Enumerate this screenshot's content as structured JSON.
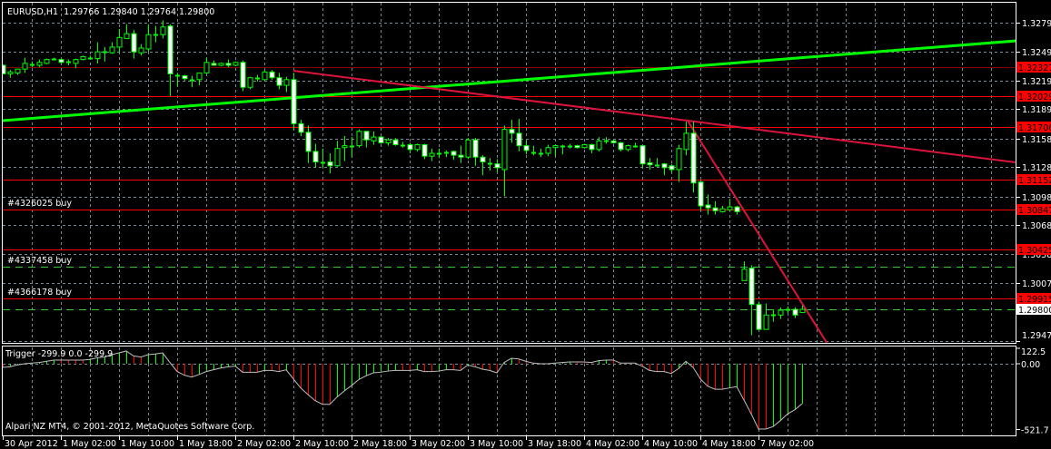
{
  "header": {
    "symbol_info": "EURUSD,H1  1.29766 1.29840 1.29764 1.29800"
  },
  "footer": {
    "copyright": "Alpari NZ MT4, © 2001-2012, MetaQuotes Software Corp."
  },
  "colors": {
    "background": "#000000",
    "grid": "#778899",
    "bull_outline": "#00ff00",
    "level_line": "#ff0000",
    "trend_up": "#00ff00",
    "trend_down": "#dc143c",
    "bid_line": "#32cd32",
    "histogram_up": "#00ff00",
    "histogram_down": "#ff0000",
    "indicator_line": "#c0c0c0"
  },
  "price_axis": {
    "ticks": [
      "1.32795",
      "1.32495",
      "1.32190",
      "1.31890",
      "1.31585",
      "1.31285",
      "1.30980",
      "1.30680",
      "1.30380",
      "1.30075",
      "1.29470"
    ],
    "level_labels": [
      "1.32327",
      "1.32029",
      "1.31706",
      "1.31152",
      "1.30847",
      "1.30425",
      "1.29915"
    ],
    "bid_label": "1.29800"
  },
  "orders": [
    {
      "label": "#4326025 buy",
      "price": 1.30847
    },
    {
      "label": "#4337458 buy",
      "price": 1.3025
    },
    {
      "label": "#4366178 buy",
      "price": 1.29915
    }
  ],
  "trendlines": [
    {
      "name": "green-trendline",
      "color": "#00ff00",
      "points": [
        [
          0,
          1.31771
        ],
        [
          139.4,
          1.32605
        ]
      ]
    },
    {
      "name": "red-trendline-upper",
      "color": "#dc143c",
      "points": [
        [
          40,
          1.32293
        ],
        [
          94.25,
          1.31771
        ],
        [
          139.4,
          1.31335
        ]
      ]
    },
    {
      "name": "red-trendline-steep",
      "color": "#dc143c",
      "points": [
        [
          94.25,
          1.31771
        ],
        [
          113.4,
          1.2945
        ]
      ]
    }
  ],
  "indicator": {
    "label": "Trigger -299.9 0.0 -299.9",
    "axis_labels": [
      "122.5",
      "0.00",
      "-521.7"
    ],
    "axis_values": [
      122.5,
      0,
      -521.7
    ],
    "values": [
      -29,
      -24,
      -10,
      0,
      5,
      10,
      19,
      29,
      29,
      29,
      29,
      29,
      34,
      48,
      53,
      72,
      86,
      101,
      62,
      53,
      72,
      77,
      86,
      10,
      -62,
      -91,
      -106,
      -86,
      -62,
      -48,
      -34,
      -24,
      -19,
      -67,
      -67,
      -67,
      -53,
      -53,
      -62,
      -48,
      -120,
      -192,
      -245,
      -293,
      -322,
      -322,
      -264,
      -216,
      -173,
      -125,
      -96,
      -72,
      -67,
      -58,
      -53,
      -53,
      -53,
      -48,
      -62,
      -62,
      -58,
      -48,
      -48,
      -53,
      -10,
      -24,
      -43,
      -53,
      -72,
      10,
      43,
      38,
      19,
      5,
      0,
      0,
      5,
      10,
      14,
      14,
      14,
      10,
      24,
      29,
      29,
      5,
      5,
      5,
      -19,
      -53,
      -62,
      -62,
      -77,
      -38,
      19,
      -29,
      -120,
      -178,
      -202,
      -202,
      -192,
      -182,
      -288,
      -398,
      -518,
      -518,
      -499,
      -451,
      -398,
      -365,
      -317
    ]
  },
  "chart_data": {
    "type": "candlestick",
    "title": "EURUSD,H1",
    "ohlc_fields": [
      "open",
      "high",
      "low",
      "close"
    ],
    "ylim": [
      1.2947,
      1.32795
    ],
    "time_labels": [
      {
        "bar": 0,
        "text": "30 Apr 2012"
      },
      {
        "bar": 8,
        "text": "1 May 02:00"
      },
      {
        "bar": 16,
        "text": "1 May 10:00"
      },
      {
        "bar": 24,
        "text": "1 May 18:00"
      },
      {
        "bar": 32,
        "text": "2 May 02:00"
      },
      {
        "bar": 40,
        "text": "2 May 10:00"
      },
      {
        "bar": 48,
        "text": "2 May 18:00"
      },
      {
        "bar": 56,
        "text": "3 May 02:00"
      },
      {
        "bar": 64,
        "text": "3 May 10:00"
      },
      {
        "bar": 72,
        "text": "3 May 18:00"
      },
      {
        "bar": 80,
        "text": "4 May 02:00"
      },
      {
        "bar": 88,
        "text": "4 May 10:00"
      },
      {
        "bar": 96,
        "text": "4 May 18:00"
      },
      {
        "bar": 104,
        "text": "7 May 02:00"
      }
    ],
    "candles": [
      [
        1.3235,
        1.3236,
        1.3226,
        1.3226
      ],
      [
        1.3226,
        1.323,
        1.3222,
        1.3228
      ],
      [
        1.3227,
        1.3231,
        1.3225,
        1.3231
      ],
      [
        1.3231,
        1.3243,
        1.3227,
        1.3237
      ],
      [
        1.3236,
        1.3239,
        1.3233,
        1.3236
      ],
      [
        1.3235,
        1.3241,
        1.3233,
        1.3238
      ],
      [
        1.3237,
        1.3242,
        1.3236,
        1.3241
      ],
      [
        1.3242,
        1.3243,
        1.324,
        1.3242
      ],
      [
        1.3241,
        1.3242,
        1.3237,
        1.3238
      ],
      [
        1.3239,
        1.3241,
        1.3235,
        1.3239
      ],
      [
        1.3237,
        1.3242,
        1.3232,
        1.3241
      ],
      [
        1.3241,
        1.3245,
        1.324,
        1.3244
      ],
      [
        1.3243,
        1.3245,
        1.3241,
        1.3243
      ],
      [
        1.3242,
        1.3259,
        1.3237,
        1.3249
      ],
      [
        1.3249,
        1.3254,
        1.3239,
        1.3249
      ],
      [
        1.3248,
        1.3259,
        1.3247,
        1.3254
      ],
      [
        1.3254,
        1.3273,
        1.3248,
        1.3264
      ],
      [
        1.3263,
        1.3278,
        1.3263,
        1.3268
      ],
      [
        1.3268,
        1.3272,
        1.3242,
        1.3249
      ],
      [
        1.3248,
        1.3257,
        1.3245,
        1.3253
      ],
      [
        1.3252,
        1.3278,
        1.3249,
        1.3267
      ],
      [
        1.3267,
        1.3276,
        1.3259,
        1.3267
      ],
      [
        1.3267,
        1.3282,
        1.3263,
        1.3275
      ],
      [
        1.3276,
        1.3278,
        1.3203,
        1.3226
      ],
      [
        1.3225,
        1.3227,
        1.3213,
        1.3225
      ],
      [
        1.3224,
        1.3225,
        1.3219,
        1.3221
      ],
      [
        1.322,
        1.3224,
        1.3212,
        1.322
      ],
      [
        1.322,
        1.3227,
        1.3214,
        1.3227
      ],
      [
        1.3227,
        1.3243,
        1.3226,
        1.3238
      ],
      [
        1.3237,
        1.324,
        1.3235,
        1.3235
      ],
      [
        1.3235,
        1.3238,
        1.3234,
        1.3237
      ],
      [
        1.3237,
        1.3241,
        1.3233,
        1.3235
      ],
      [
        1.3235,
        1.3239,
        1.3234,
        1.3238
      ],
      [
        1.3238,
        1.324,
        1.3208,
        1.3212
      ],
      [
        1.3212,
        1.3223,
        1.321,
        1.3222
      ],
      [
        1.3222,
        1.3225,
        1.3218,
        1.3222
      ],
      [
        1.322,
        1.323,
        1.3218,
        1.3228
      ],
      [
        1.3228,
        1.323,
        1.322,
        1.3222
      ],
      [
        1.3222,
        1.3227,
        1.321,
        1.3214
      ],
      [
        1.3214,
        1.3223,
        1.3207,
        1.322
      ],
      [
        1.322,
        1.3227,
        1.3167,
        1.3174
      ],
      [
        1.3174,
        1.3178,
        1.3161,
        1.3165
      ],
      [
        1.3165,
        1.3172,
        1.3133,
        1.3145
      ],
      [
        1.3145,
        1.3153,
        1.3128,
        1.3134
      ],
      [
        1.3134,
        1.3148,
        1.3128,
        1.3134
      ],
      [
        1.3134,
        1.3143,
        1.3122,
        1.313
      ],
      [
        1.313,
        1.3156,
        1.3129,
        1.3148
      ],
      [
        1.3149,
        1.3161,
        1.3135,
        1.3151
      ],
      [
        1.3151,
        1.316,
        1.3139,
        1.3151
      ],
      [
        1.3151,
        1.3168,
        1.3149,
        1.3166
      ],
      [
        1.3166,
        1.3166,
        1.3149,
        1.3157
      ],
      [
        1.3156,
        1.3166,
        1.3152,
        1.316
      ],
      [
        1.316,
        1.3161,
        1.3153,
        1.3154
      ],
      [
        1.3154,
        1.3159,
        1.3151,
        1.3157
      ],
      [
        1.3157,
        1.3159,
        1.3151,
        1.3152
      ],
      [
        1.3152,
        1.3155,
        1.3149,
        1.3152
      ],
      [
        1.3152,
        1.3154,
        1.3143,
        1.3147
      ],
      [
        1.3147,
        1.3153,
        1.3145,
        1.3152
      ],
      [
        1.3152,
        1.3153,
        1.3137,
        1.314
      ],
      [
        1.314,
        1.3148,
        1.3135,
        1.3143
      ],
      [
        1.3143,
        1.3148,
        1.3138,
        1.3143
      ],
      [
        1.3144,
        1.3146,
        1.3139,
        1.3144
      ],
      [
        1.3145,
        1.3146,
        1.3136,
        1.3141
      ],
      [
        1.3141,
        1.3151,
        1.3133,
        1.3139
      ],
      [
        1.3139,
        1.3159,
        1.3137,
        1.3157
      ],
      [
        1.3157,
        1.3159,
        1.313,
        1.3139
      ],
      [
        1.3139,
        1.3141,
        1.312,
        1.3134
      ],
      [
        1.3133,
        1.3138,
        1.3125,
        1.3133
      ],
      [
        1.3132,
        1.3137,
        1.3123,
        1.3128
      ],
      [
        1.3126,
        1.3172,
        1.3098,
        1.3168
      ],
      [
        1.3168,
        1.3178,
        1.3154,
        1.3164
      ],
      [
        1.3164,
        1.3179,
        1.3145,
        1.3151
      ],
      [
        1.3151,
        1.3156,
        1.3142,
        1.3146
      ],
      [
        1.3144,
        1.3151,
        1.3141,
        1.3144
      ],
      [
        1.3143,
        1.3148,
        1.3139,
        1.3143
      ],
      [
        1.3143,
        1.3152,
        1.314,
        1.3149
      ],
      [
        1.3149,
        1.3152,
        1.314,
        1.3151
      ],
      [
        1.3151,
        1.3152,
        1.3142,
        1.3151
      ],
      [
        1.3151,
        1.3153,
        1.3148,
        1.3151
      ],
      [
        1.3151,
        1.3152,
        1.3148,
        1.3149
      ],
      [
        1.3149,
        1.3153,
        1.3148,
        1.3152
      ],
      [
        1.3152,
        1.3153,
        1.3143,
        1.3147
      ],
      [
        1.3147,
        1.316,
        1.3145,
        1.3156
      ],
      [
        1.3156,
        1.316,
        1.3153,
        1.3156
      ],
      [
        1.3156,
        1.3157,
        1.3153,
        1.3154
      ],
      [
        1.3154,
        1.3155,
        1.3145,
        1.3147
      ],
      [
        1.3147,
        1.3152,
        1.3145,
        1.3151
      ],
      [
        1.3151,
        1.3154,
        1.3149,
        1.3151
      ],
      [
        1.3151,
        1.3152,
        1.3128,
        1.3132
      ],
      [
        1.3133,
        1.3138,
        1.3126,
        1.3131
      ],
      [
        1.3131,
        1.3138,
        1.3129,
        1.3131
      ],
      [
        1.3132,
        1.3133,
        1.312,
        1.3128
      ],
      [
        1.313,
        1.3132,
        1.3123,
        1.3126
      ],
      [
        1.3126,
        1.3152,
        1.3113,
        1.3148
      ],
      [
        1.3147,
        1.3176,
        1.3141,
        1.3164
      ],
      [
        1.3164,
        1.3176,
        1.3102,
        1.3112
      ],
      [
        1.3113,
        1.3115,
        1.3083,
        1.3088
      ],
      [
        1.3089,
        1.31,
        1.3079,
        1.3086
      ],
      [
        1.3086,
        1.3093,
        1.3079,
        1.3083
      ],
      [
        1.3082,
        1.3088,
        1.3081,
        1.3085
      ],
      [
        1.3084,
        1.3095,
        1.3083,
        1.3087
      ],
      [
        1.3087,
        1.3088,
        1.3079,
        1.3082
      ],
      [
        1.301,
        1.303,
        1.301,
        1.3022
      ],
      [
        1.3023,
        1.3026,
        1.2953,
        1.2985
      ],
      [
        1.2985,
        1.2988,
        1.2959,
        1.2959
      ],
      [
        1.2959,
        1.2986,
        1.2959,
        1.2974
      ],
      [
        1.2974,
        1.298,
        1.2967,
        1.2974
      ],
      [
        1.2974,
        1.2982,
        1.297,
        1.2979
      ],
      [
        1.298,
        1.2983,
        1.2976,
        1.298
      ],
      [
        1.298,
        1.2982,
        1.2971,
        1.2974
      ],
      [
        1.29766,
        1.2984,
        1.29764,
        1.298
      ]
    ]
  }
}
